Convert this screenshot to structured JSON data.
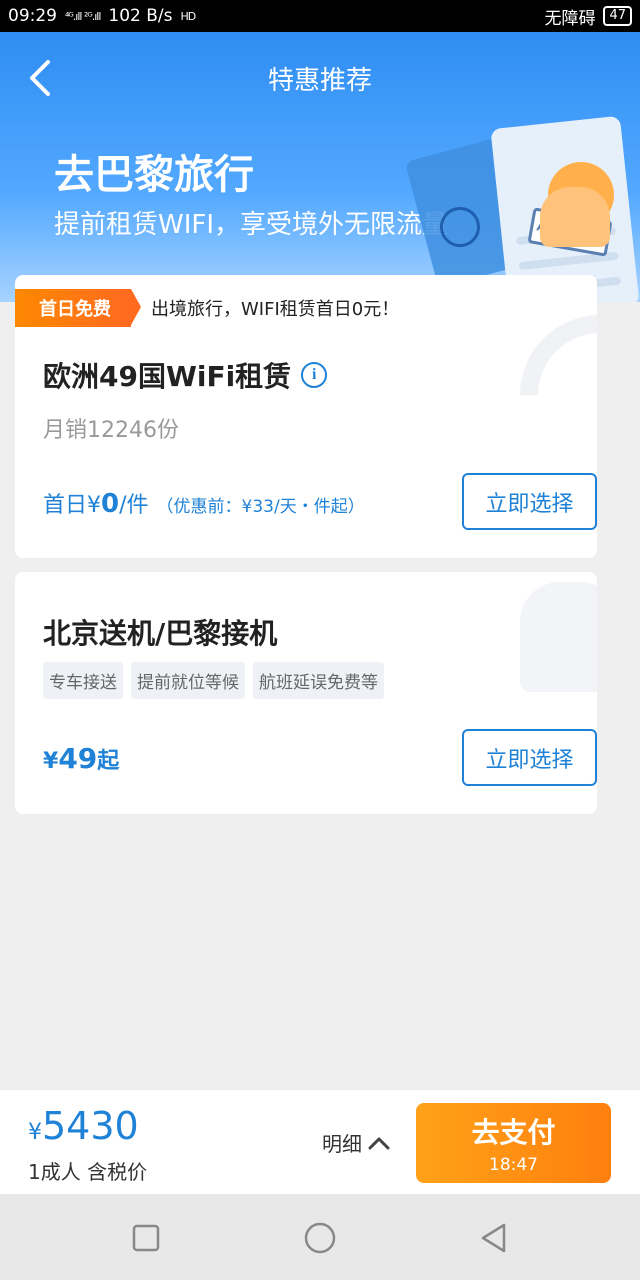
{
  "status_bar": {
    "time": "09:29",
    "signal": "⁴ᴳ.ıll ²ᴳ.ıll",
    "speed": "102 B/s",
    "hd": "HD",
    "carrier": "无障碍",
    "battery": "47"
  },
  "header": {
    "title": "特惠推荐"
  },
  "banner": {
    "title": "去巴黎旅行",
    "subtitle": "提前租赁WIFI，享受境外无限流量",
    "stamp_text": "APPROVED"
  },
  "products": [
    {
      "badge": "首日免费",
      "badge_text": "出境旅行，WIFI租赁首日0元！",
      "title": "欧洲49国WiFi租赁",
      "sales": "月销12246份",
      "price_prefix": "首日¥",
      "price_value": "0",
      "price_unit": "/件",
      "price_note": "（优惠前：¥33/天・件起）",
      "button": "立即选择"
    },
    {
      "title": "北京送机/巴黎接机",
      "tags": [
        "专车接送",
        "提前就位等候",
        "航班延误免费等"
      ],
      "price_currency": "¥",
      "price_value": "49",
      "price_suffix": "起",
      "button": "立即选择"
    }
  ],
  "footer": {
    "currency": "¥",
    "total": "5430",
    "sub": "1成人 含税价",
    "detail": "明细",
    "pay_label": "去支付",
    "timer": "18:47"
  },
  "colors": {
    "primary": "#1f82d6",
    "accent": "#ff8a00"
  }
}
